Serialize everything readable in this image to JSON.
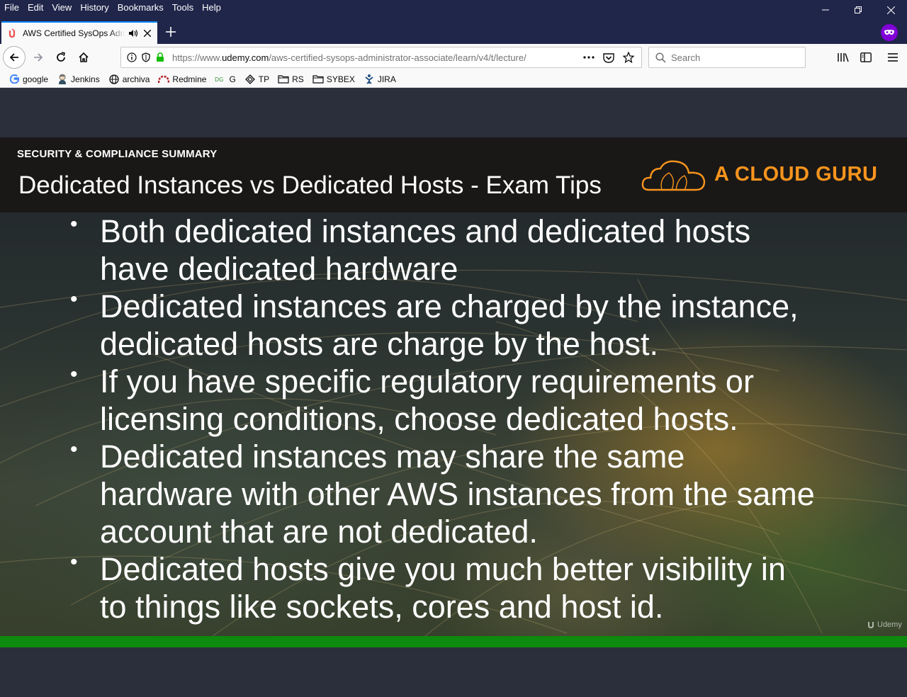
{
  "menubar": {
    "items": [
      "File",
      "Edit",
      "View",
      "History",
      "Bookmarks",
      "Tools",
      "Help"
    ]
  },
  "tab": {
    "title": "AWS Certified SysOps Administrator - Associate | Udemy"
  },
  "urlbar": {
    "prefix": "https://www.",
    "host": "udemy.com",
    "path": "/aws-certified-sysops-administrator-associate/learn/v4/t/lecture/"
  },
  "search": {
    "placeholder": "Search"
  },
  "bookmarks": [
    {
      "label": "google",
      "icon": "google-icon"
    },
    {
      "label": "Jenkins",
      "icon": "jenkins-icon"
    },
    {
      "label": "archiva",
      "icon": "globe-icon"
    },
    {
      "label": "Redmine",
      "icon": "redmine-icon"
    },
    {
      "label": "G",
      "icon": "g-icon"
    },
    {
      "label": "TP",
      "icon": "diamond-icon"
    },
    {
      "label": "RS",
      "icon": "folder-icon"
    },
    {
      "label": "SYBEX",
      "icon": "folder-icon"
    },
    {
      "label": "JIRA",
      "icon": "jira-icon"
    }
  ],
  "slide": {
    "section": "SECURITY & COMPLIANCE SUMMARY",
    "title": "Dedicated Instances vs Dedicated Hosts - Exam Tips",
    "brand": "A CLOUD GURU",
    "watermark": "Udemy",
    "bullets": [
      "Both dedicated instances and dedicated hosts have dedicated hardware",
      "Dedicated instances are charged by the instance, dedicated hosts are charge by the host.",
      "If you have specific regulatory requirements or licensing conditions, choose dedicated hosts.",
      "Dedicated instances may share the same hardware with other AWS instances from the same account that are not dedicated.",
      "Dedicated hosts give you much better visibility in to things like sockets, cores and host id."
    ]
  },
  "colors": {
    "chrome_dark": "#20254a",
    "brand_orange": "#f7941d",
    "progress_green": "#0e8a0e",
    "private_purple": "#8000d7"
  }
}
